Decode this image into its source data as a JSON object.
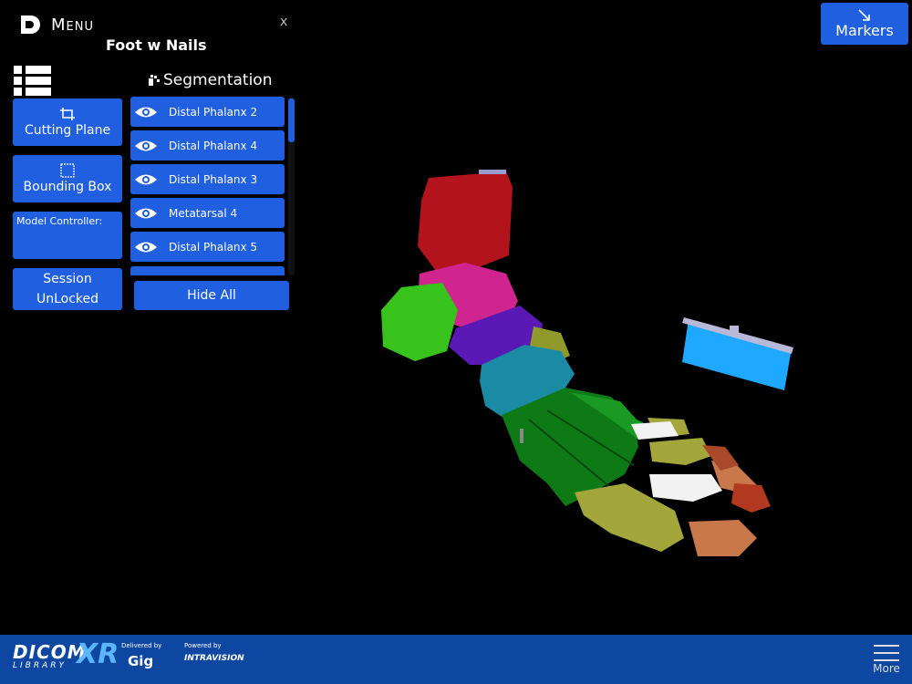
{
  "menu": {
    "title": "Menu",
    "close": "x",
    "model_name": "Foot w Nails"
  },
  "left_controls": {
    "cutting_plane": "Cutting Plane",
    "bounding_box": "Bounding Box",
    "model_controller": "Model Controller:",
    "session_line1": "Session",
    "session_line2": "UnLocked"
  },
  "segmentation": {
    "header": "Segmentation",
    "items": [
      {
        "label": "Distal Phalanx 2"
      },
      {
        "label": "Distal Phalanx 4"
      },
      {
        "label": "Distal Phalanx 3"
      },
      {
        "label": "Metatarsal 4"
      },
      {
        "label": "Distal Phalanx 5"
      }
    ],
    "hide_all": "Hide All"
  },
  "markers": {
    "label": "Markers"
  },
  "footer": {
    "dicom": "DICOM",
    "library": "LIBRARY",
    "xr": "XR",
    "delivered_by": "Delivered by",
    "gig": "Gig",
    "powered_by": "Powered by",
    "intravision": "INTRAVISION",
    "more": "More"
  },
  "colors": {
    "accent": "#1f5fe0",
    "footer_bg": "#0d47a1",
    "background": "#000000"
  }
}
